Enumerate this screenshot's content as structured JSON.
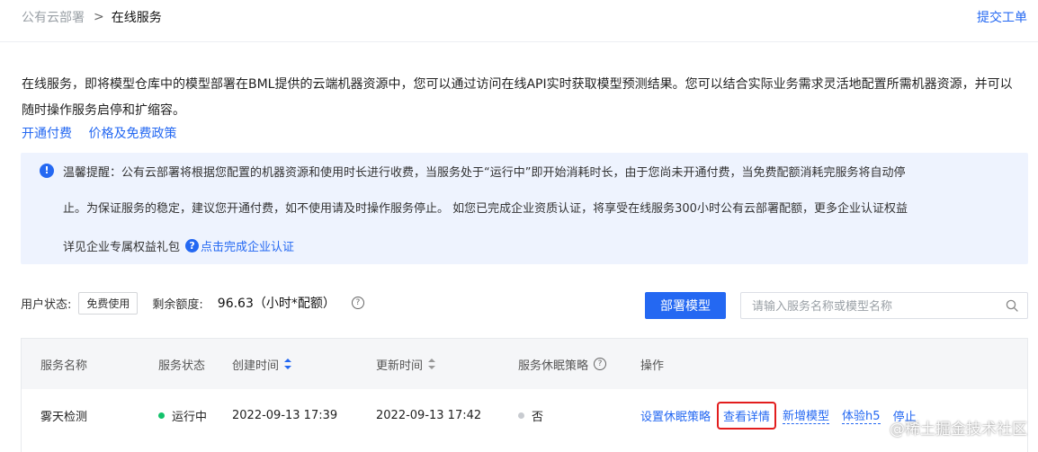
{
  "breadcrumb": {
    "parent": "公有云部署",
    "current": "在线服务"
  },
  "header": {
    "ticket_link": "提交工单"
  },
  "intro": {
    "text": "在线服务，即将模型仓库中的模型部署在BML提供的云端机器资源中，您可以通过访问在线API实时获取模型预测结果。您可以结合实际业务需求灵活地配置所需机器资源，并可以随时操作服务启停和扩缩容。",
    "links": [
      "开通付费",
      "价格及免费政策"
    ]
  },
  "alert": {
    "line1": "温馨提醒：公有云部署将根据您配置的机器资源和使用时长进行收费，当服务处于“运行中”即开始消耗时长，由于您尚未开通付费，当免费配额消耗完服务将自动停",
    "line2": "止。为保证服务的稳定，建议您开通付费，如不使用请及时操作服务停止。 如您已完成企业资质认证，将享受在线服务300小时公有云部署配额，更多企业认证权益",
    "line3": "详见企业专属权益礼包",
    "certify_link": "点击完成企业认证"
  },
  "user_status": {
    "label": "用户状态:",
    "badge": "免费使用",
    "quota_label": "剩余额度:",
    "quota_value": "96.63（小时*配额）"
  },
  "actions": {
    "deploy_button": "部署模型",
    "search_placeholder": "请输入服务名称或模型名称"
  },
  "table": {
    "headers": {
      "name": "服务名称",
      "status": "服务状态",
      "created": "创建时间",
      "updated": "更新时间",
      "sleep": "服务休眠策略",
      "ops": "操作"
    },
    "rows": [
      {
        "name": "雾天检测",
        "status": "运行中",
        "created": "2022-09-13 17:39",
        "updated": "2022-09-13 17:42",
        "sleep": "否",
        "ops": [
          "设置休眠策略",
          "查看详情",
          "新增模型",
          "体验h5",
          "停止"
        ]
      }
    ]
  },
  "watermark": "@稀土掘金技术社区",
  "colors": {
    "accent": "#2468f2",
    "running": "#13c26b",
    "inactive": "#c8cbd0",
    "highlight": "#e21d1d"
  }
}
